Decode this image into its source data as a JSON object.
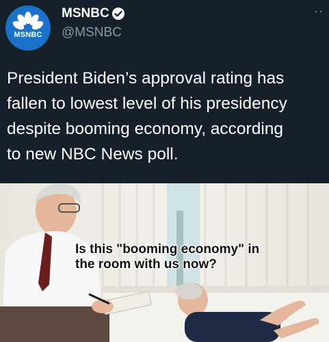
{
  "tweet": {
    "display_name": "MSNBC",
    "handle": "@MSNBC",
    "avatar_logo_text": "MSNBC",
    "more_label": "··",
    "text": "President Biden’s approval rating has\nfallen to lowest level of his presidency\ndespite booming economy, according\nto new NBC News poll."
  },
  "meme": {
    "caption": "Is this \"booming economy\" in\nthe room with us now?"
  },
  "colors": {
    "background": "#15202b",
    "text": "#ffffff",
    "secondary_text": "#8b98a5",
    "avatar": "#1a73c8"
  }
}
